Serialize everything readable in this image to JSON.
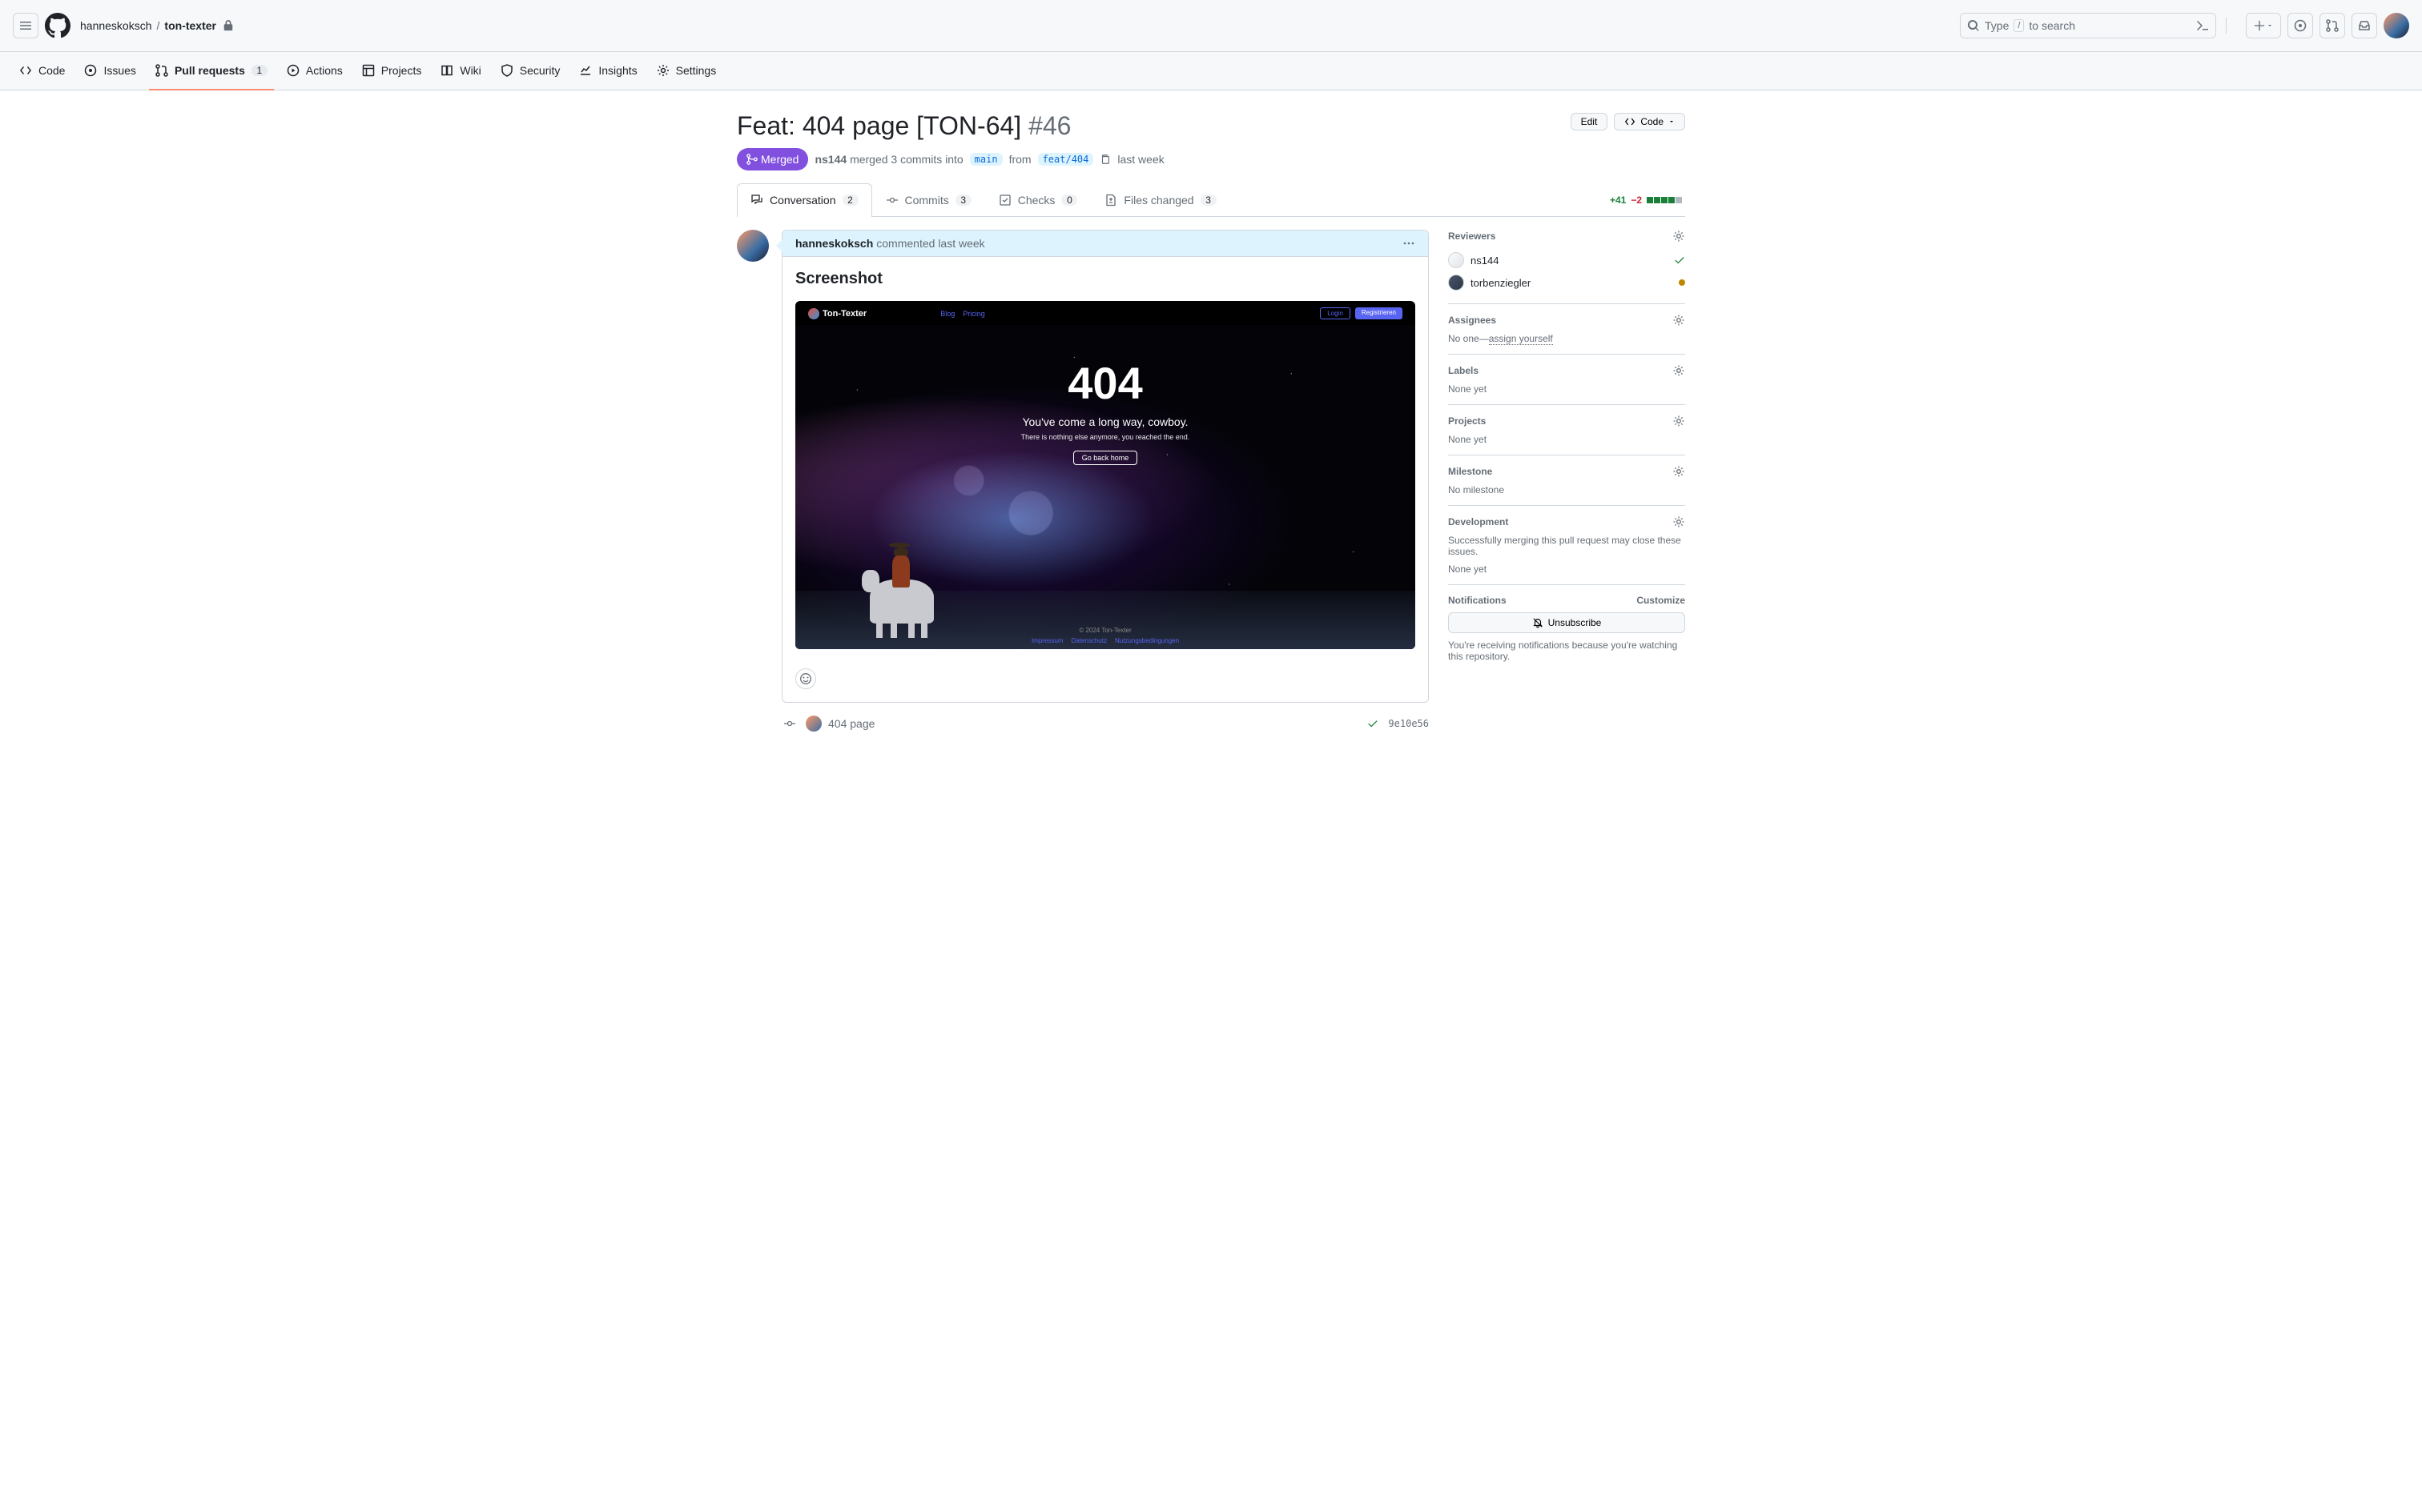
{
  "header": {
    "owner": "hanneskoksch",
    "repo": "ton-texter",
    "search_placeholder": "Type",
    "search_suffix": "to search"
  },
  "repo_nav": {
    "code": "Code",
    "issues": "Issues",
    "pulls": "Pull requests",
    "pulls_count": "1",
    "actions": "Actions",
    "projects": "Projects",
    "wiki": "Wiki",
    "security": "Security",
    "insights": "Insights",
    "settings": "Settings"
  },
  "pr": {
    "title": "Feat: 404 page [TON-64]",
    "number": "#46",
    "state": "Merged",
    "author": "ns144",
    "merge_text_1": "merged 3 commits into",
    "base_branch": "main",
    "merge_text_2": "from",
    "head_branch": "feat/404",
    "time": "last week",
    "edit": "Edit",
    "code_btn": "Code"
  },
  "tabs": {
    "conversation": "Conversation",
    "conversation_count": "2",
    "commits": "Commits",
    "commits_count": "3",
    "checks": "Checks",
    "checks_count": "0",
    "files": "Files changed",
    "files_count": "3",
    "additions": "+41",
    "deletions": "−2"
  },
  "comment": {
    "author": "hanneskoksch",
    "action": "commented",
    "time": "last week",
    "heading": "Screenshot",
    "ss": {
      "brand": "Ton-Texter",
      "nav_blog": "Blog",
      "nav_pricing": "Pricing",
      "login": "Login",
      "register": "Registrieren",
      "h1": "404",
      "sub": "You've come a long way, cowboy.",
      "sub2": "There is nothing else anymore, you reached the end.",
      "home": "Go back home",
      "copyright": "© 2024 Ton-Texter",
      "f1": "Impressum",
      "f2": "Datenschutz",
      "f3": "Nutzungsbedingungen"
    }
  },
  "commit": {
    "msg": "404 page",
    "sha": "9e10e56"
  },
  "sidebar": {
    "reviewers": {
      "title": "Reviewers",
      "r1": "ns144",
      "r2": "torbenziegler"
    },
    "assignees": {
      "title": "Assignees",
      "none": "No one—",
      "assign": "assign yourself"
    },
    "labels": {
      "title": "Labels",
      "none": "None yet"
    },
    "projects": {
      "title": "Projects",
      "none": "None yet"
    },
    "milestone": {
      "title": "Milestone",
      "none": "No milestone"
    },
    "development": {
      "title": "Development",
      "desc": "Successfully merging this pull request may close these issues.",
      "none": "None yet"
    },
    "notifications": {
      "title": "Notifications",
      "customize": "Customize",
      "unsubscribe": "Unsubscribe",
      "reason": "You're receiving notifications because you're watching this repository."
    }
  }
}
